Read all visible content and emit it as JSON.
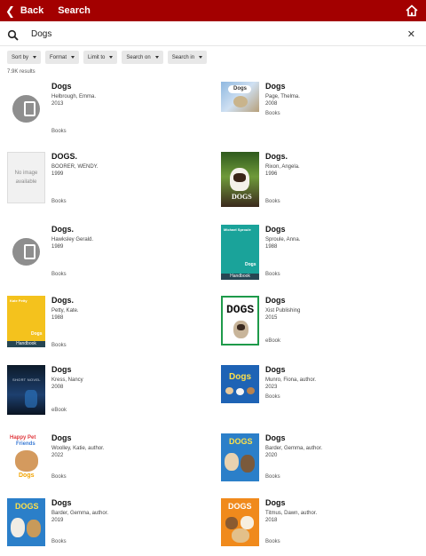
{
  "header": {
    "back_label": "Back",
    "title": "Search"
  },
  "search": {
    "query": "Dogs"
  },
  "filters": [
    "Sort by",
    "Format",
    "Limit to",
    "Search on",
    "Search in"
  ],
  "result_count": "7.9K results",
  "no_image_text": "No image available",
  "cover_text": {
    "handbook": "Handbook",
    "small_dogs": "Dogs",
    "big_dogs": "DOGS",
    "sproule_author": "Michael Sproule",
    "petty_author": "Kate Petty",
    "woolley_line1": "Happy Pet",
    "woolley_line2": "Friends",
    "kress_text": "SHORT NOVEL"
  },
  "results": [
    {
      "title": "Dogs",
      "author": "Helbrough, Emma.",
      "year": "2013",
      "format": "Books"
    },
    {
      "title": "Dogs",
      "author": "Page, Thelma.",
      "year": "2008",
      "format": "Books"
    },
    {
      "title": "DOGS.",
      "author": "BOORER, WENDY.",
      "year": "1999",
      "format": "Books"
    },
    {
      "title": "Dogs.",
      "author": "Rixon, Angela.",
      "year": "1996",
      "format": "Books"
    },
    {
      "title": "Dogs.",
      "author": "Hawksley Gerald.",
      "year": "1989",
      "format": "Books"
    },
    {
      "title": "Dogs",
      "author": "Sproule, Anna.",
      "year": "1988",
      "format": "Books"
    },
    {
      "title": "Dogs.",
      "author": "Petty, Kate.",
      "year": "1988",
      "format": "Books"
    },
    {
      "title": "Dogs",
      "author": "Xist Publishing",
      "year": "2015",
      "format": "eBook"
    },
    {
      "title": "Dogs",
      "author": "Kress, Nancy",
      "year": "2008",
      "format": "eBook"
    },
    {
      "title": "Dogs",
      "author": "Munro, Fiona, author.",
      "year": "2023",
      "format": "Books"
    },
    {
      "title": "Dogs",
      "author": "Woolley, Katie, author.",
      "year": "2022",
      "format": "Books"
    },
    {
      "title": "Dogs",
      "author": "Barder, Gemma, author.",
      "year": "2020",
      "format": "Books"
    },
    {
      "title": "Dogs",
      "author": "Barder, Gemma, author.",
      "year": "2019",
      "format": "Books"
    },
    {
      "title": "Dogs",
      "author": "Titmus, Dawn, author.",
      "year": "2018",
      "format": "Books"
    }
  ],
  "colors": {
    "header": "#a30000",
    "chip": "#e8e8e8",
    "placeholder": "#8e8e8e"
  }
}
